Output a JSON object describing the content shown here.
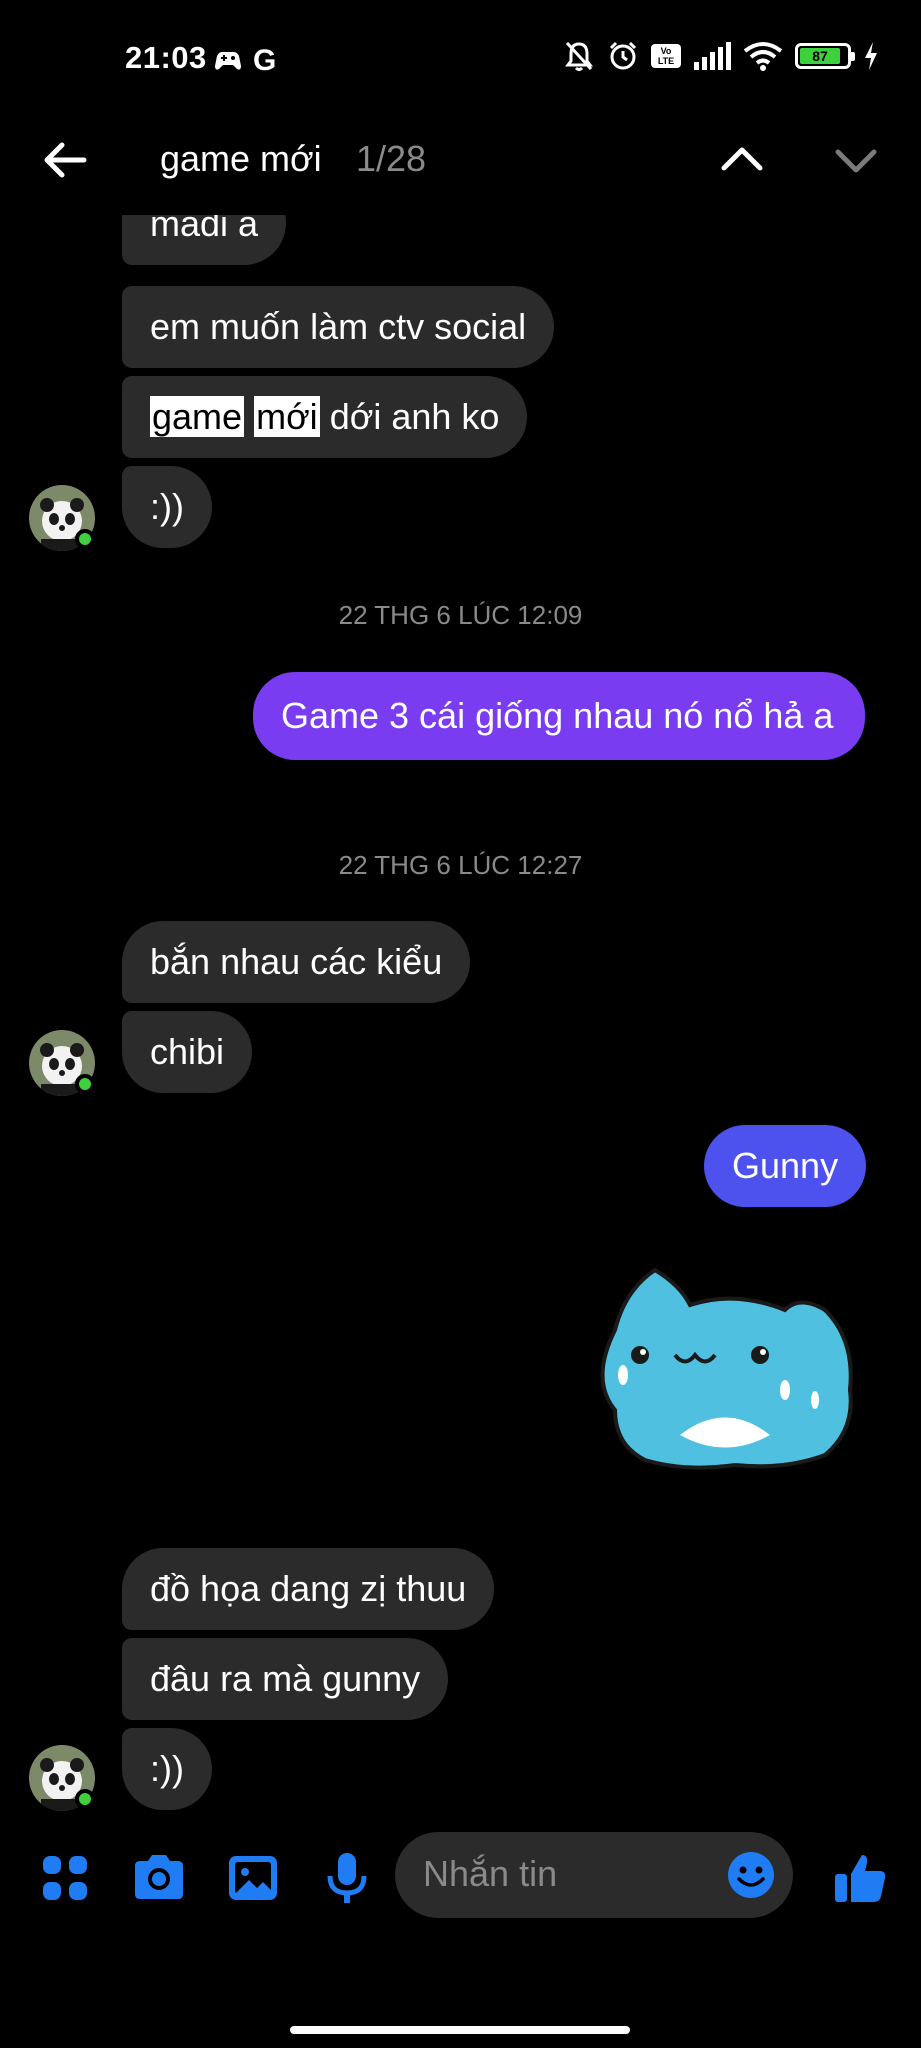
{
  "status_bar": {
    "time": "21:03",
    "google_letter": "G",
    "battery_level": "87",
    "volte_label": "Vo\nLTE"
  },
  "search": {
    "query": "game mới",
    "count": "1/28"
  },
  "messages": {
    "m1": "madi à",
    "m2": "em muốn làm ctv social",
    "m3_hl1": "game",
    "m3_hl2": "mới",
    "m3_rest": "dới anh ko",
    "m4": ":))",
    "ts1": "22 THG 6 LÚC 12:09",
    "sent1": "Game 3 cái giống nhau nó nổ hả a",
    "ts2": "22 THG 6 LÚC 12:27",
    "m5": "bắn nhau các kiểu",
    "m6": "chibi",
    "sent2": "Gunny",
    "m7": "đồ họa dang zị thuu",
    "m8": "đâu ra mà gunny",
    "m9": ":))"
  },
  "composer": {
    "placeholder": "Nhắn tin"
  },
  "colors": {
    "received_bubble": "#2b2b2b",
    "sent_purple": "#7a3cf0",
    "sent_blue": "#4d52ee",
    "accent_icon": "#1f7cf2",
    "online": "#3fcf3f"
  },
  "icons": [
    "back-arrow-icon",
    "chevron-up-icon",
    "chevron-down-icon",
    "menu-dots-icon",
    "camera-icon",
    "image-icon",
    "microphone-icon",
    "emoji-icon",
    "thumbs-up-icon"
  ]
}
